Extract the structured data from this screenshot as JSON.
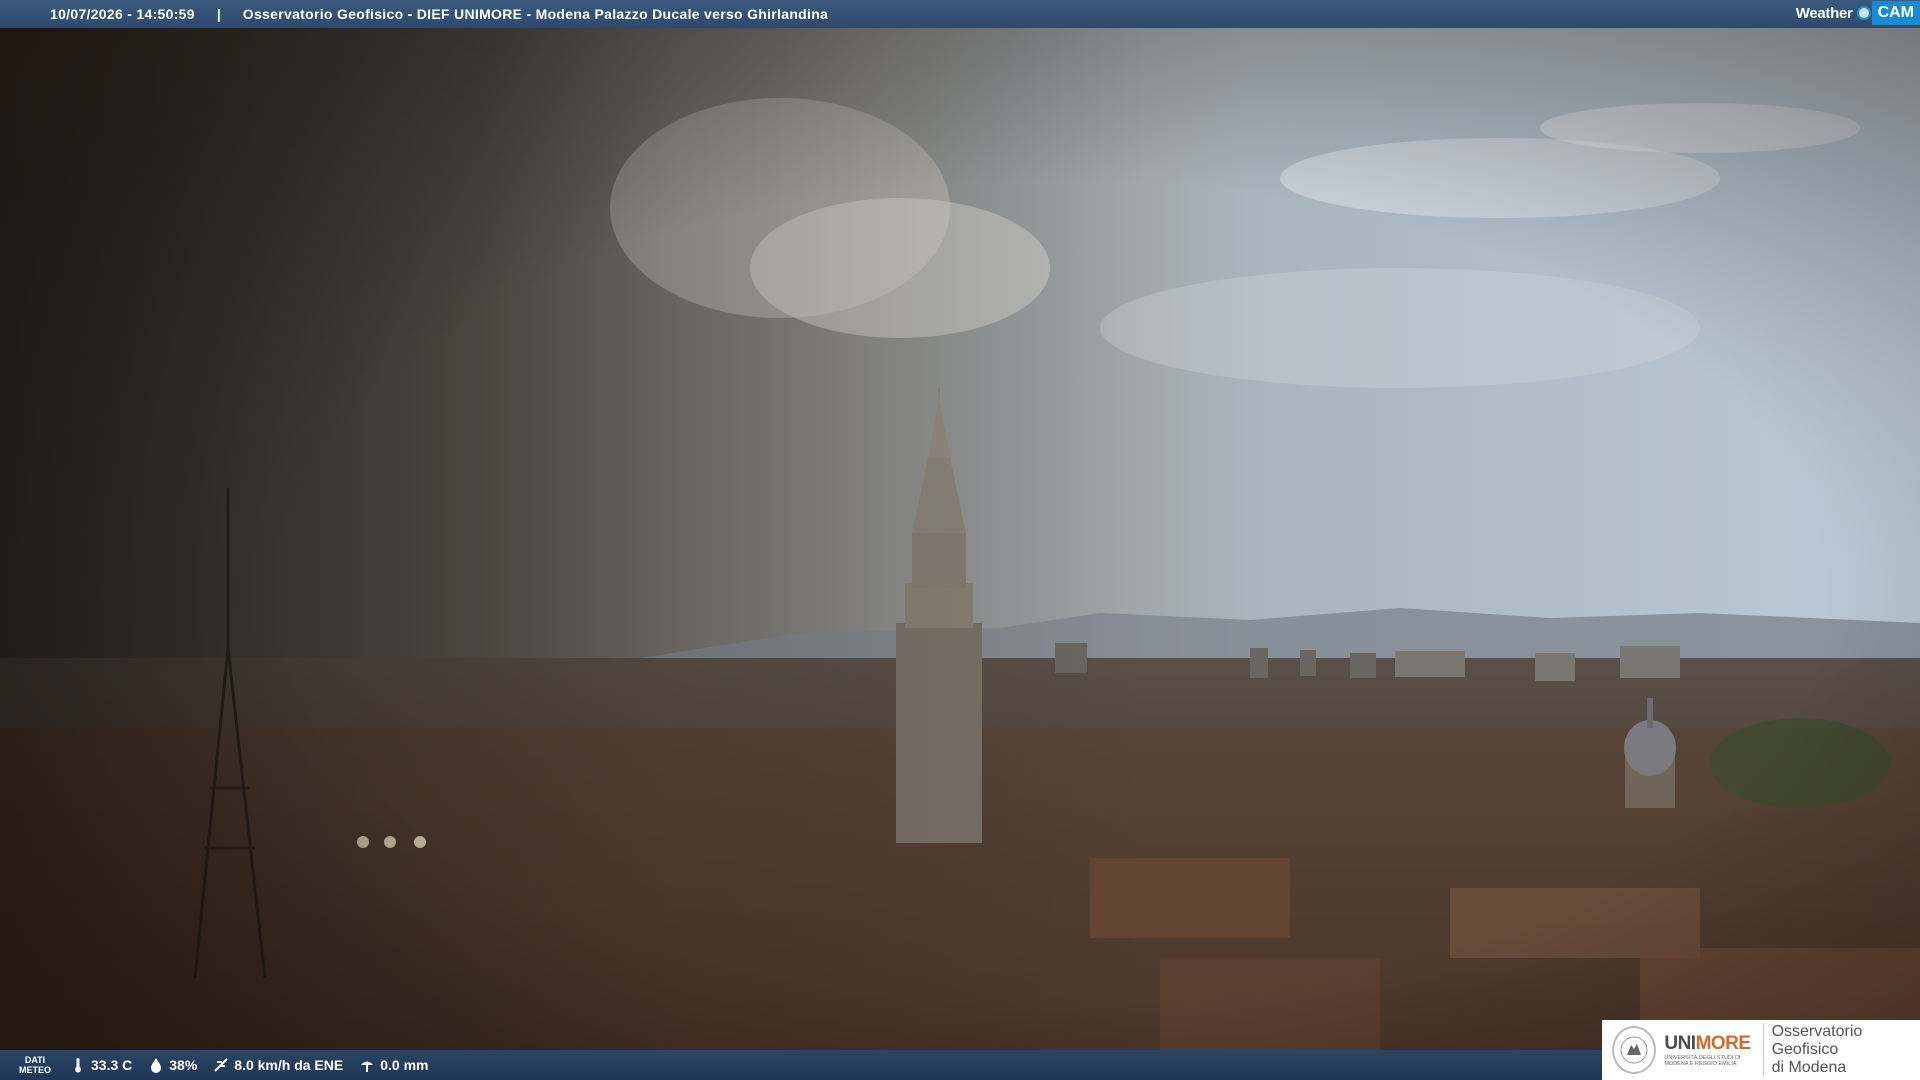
{
  "header": {
    "timestamp": "10/07/2026 - 14:50:59",
    "separator": "|",
    "title": "Osservatorio Geofisico - DIEF UNIMORE - Modena Palazzo Ducale verso Ghirlandina"
  },
  "brand": {
    "weather": "Weather",
    "cam": "CAM"
  },
  "footer": {
    "dati_line1": "DATI",
    "dati_line2": "METEO",
    "temperature": "33.3 C",
    "humidity": "38%",
    "wind": "8.0 km/h da ENE",
    "rain": "0.0 mm"
  },
  "logo": {
    "unimore_a": "UNI",
    "unimore_b": "MORE",
    "unimore_sub": "UNIVERSITÀ DEGLI STUDI DI MODENA E REGGIO EMILIA",
    "osservatorio_line1": "Osservatorio Geofisico",
    "osservatorio_line2": "di Modena"
  },
  "colors": {
    "bar_blue": "#2d4a6c",
    "accent_blue": "#1a8ad2",
    "unimore_orange": "#d26a2c"
  },
  "icons": [
    "thermometer-icon",
    "humidity-drop-icon",
    "wind-icon",
    "rain-gauge-icon",
    "weathercam-logo-icon"
  ]
}
